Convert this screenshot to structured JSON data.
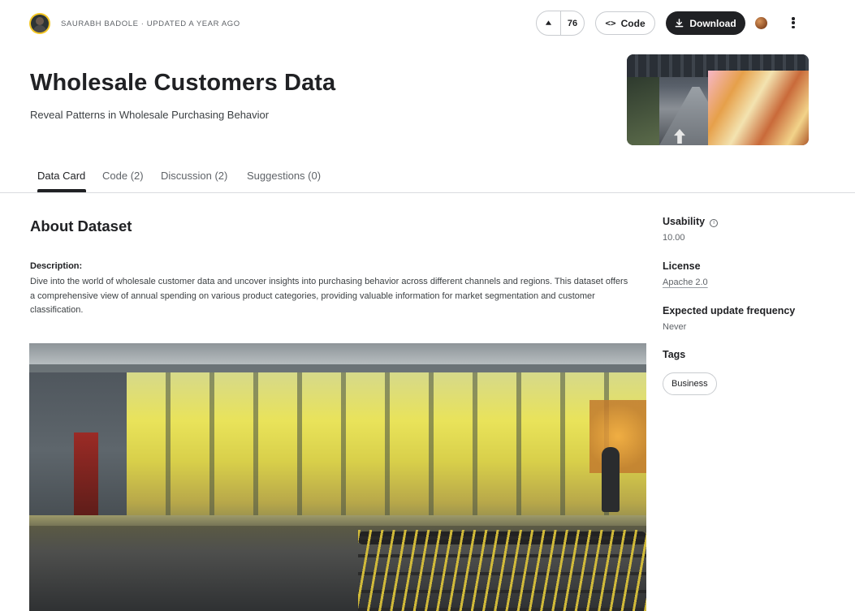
{
  "header": {
    "author": "SAURABH BADOLE",
    "updated": "· UPDATED A YEAR AGO",
    "upvotes": "76",
    "code_label": "Code",
    "download_label": "Download",
    "title": "Wholesale Customers Data",
    "subtitle": "Reveal Patterns in Wholesale Purchasing Behavior"
  },
  "tabs": [
    {
      "label": "Data Card",
      "active": true
    },
    {
      "label": "Code (2)"
    },
    {
      "label": "Discussion (2)"
    },
    {
      "label": "Suggestions (0)"
    }
  ],
  "about": {
    "heading": "About Dataset",
    "description_label": "Description:",
    "description": "Dive into the world of wholesale customer data and uncover insights into purchasing behavior across different channels and regions. This dataset offers a comprehensive view of annual spending on various product categories, providing valuable information for market segmentation and customer classification."
  },
  "sidebar": {
    "usability_label": "Usability",
    "usability_value": "10.00",
    "license_label": "License",
    "license_value": "Apache 2.0",
    "frequency_label": "Expected update frequency",
    "frequency_value": "Never",
    "tags_label": "Tags",
    "tags": [
      "Business"
    ]
  },
  "icons": {
    "upvote": "upvote-arrow-icon",
    "code": "code-brackets-icon",
    "download": "download-icon",
    "more": "kebab-menu-icon",
    "info": "info-icon"
  },
  "colors": {
    "primary_button": "#202124",
    "avatar_ring": "#f3c623",
    "border": "#c9ccd0"
  }
}
